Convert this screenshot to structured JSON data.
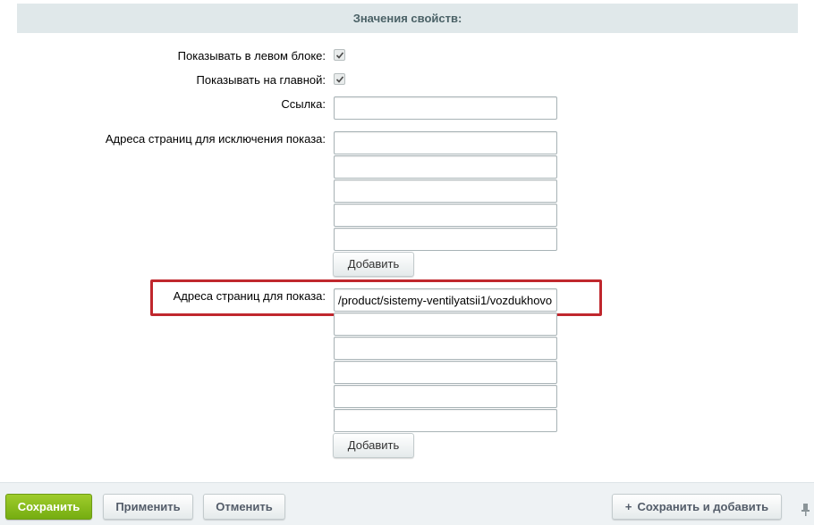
{
  "header": {
    "title": "Значения свойств:"
  },
  "fields": {
    "show_left_label": "Показывать в левом блоке:",
    "show_main_label": "Показывать на главной:",
    "link_label": "Ссылка:",
    "exclude_label": "Адреса страниц для исключения показа:",
    "show_pages_label": "Адреса страниц для показа:"
  },
  "inputs": {
    "link": "",
    "exclude": [
      "",
      "",
      "",
      "",
      ""
    ],
    "show_pages": [
      "/product/sistemy-ventilyatsii1/vozdukhovo",
      "",
      "",
      "",
      "",
      ""
    ]
  },
  "buttons": {
    "add_exclude": "Добавить",
    "add_show": "Добавить"
  },
  "footer": {
    "save": "Сохранить",
    "apply": "Применить",
    "cancel": "Отменить",
    "save_and_add": "Сохранить и добавить"
  },
  "colors": {
    "highlight": "#c0272d",
    "save_button": "#8bbd1f",
    "header_bg": "#e0e8ea"
  }
}
